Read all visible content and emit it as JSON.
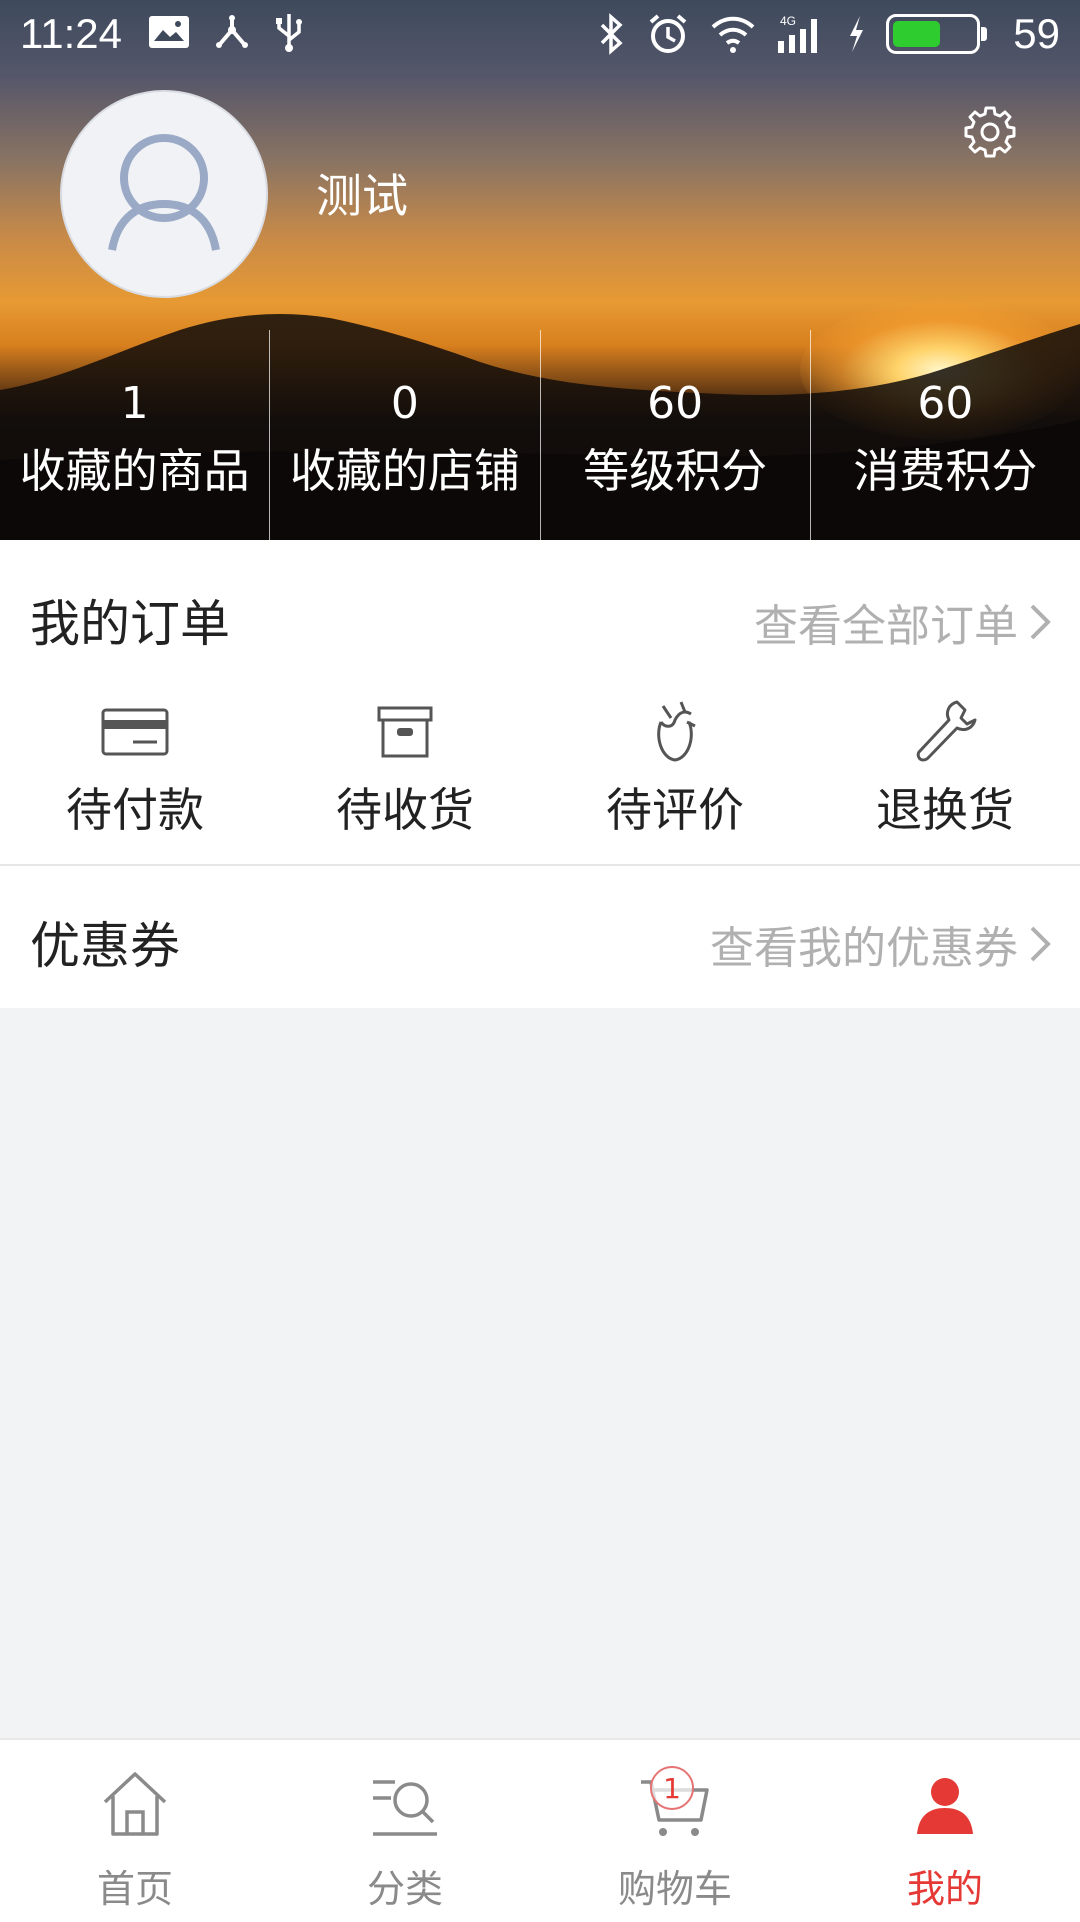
{
  "status_bar": {
    "time": "11:24",
    "battery_level": "59",
    "battery_fraction": 0.59,
    "network_label": "4G",
    "left_icons": [
      "image-icon",
      "share-icon",
      "usb-icon"
    ],
    "right_icons": [
      "bluetooth-icon",
      "alarm-icon",
      "wifi-icon",
      "signal-icon",
      "charging-icon",
      "battery-icon"
    ]
  },
  "profile": {
    "username": "测试",
    "avatar_icon": "user-avatar-icon",
    "settings_icon": "gear-icon"
  },
  "stats": [
    {
      "value": "1",
      "label": "收藏的商品"
    },
    {
      "value": "0",
      "label": "收藏的店铺"
    },
    {
      "value": "60",
      "label": "等级积分"
    },
    {
      "value": "60",
      "label": "消费积分"
    }
  ],
  "orders": {
    "title": "我的订单",
    "view_all": "查看全部订单",
    "items": [
      {
        "label": "待付款",
        "icon": "card-icon"
      },
      {
        "label": "待收货",
        "icon": "box-icon"
      },
      {
        "label": "待评价",
        "icon": "flower-icon"
      },
      {
        "label": "退换货",
        "icon": "wrench-icon"
      }
    ]
  },
  "coupons": {
    "title": "优惠券",
    "view_all": "查看我的优惠券"
  },
  "tabbar": {
    "active_color": "#e53935",
    "inactive_color": "#8a8a8a",
    "cart_badge": "1",
    "tabs": [
      {
        "label": "首页",
        "icon": "home-icon"
      },
      {
        "label": "分类",
        "icon": "category-search-icon"
      },
      {
        "label": "购物车",
        "icon": "cart-icon"
      },
      {
        "label": "我的",
        "icon": "person-icon",
        "active": true
      }
    ]
  }
}
